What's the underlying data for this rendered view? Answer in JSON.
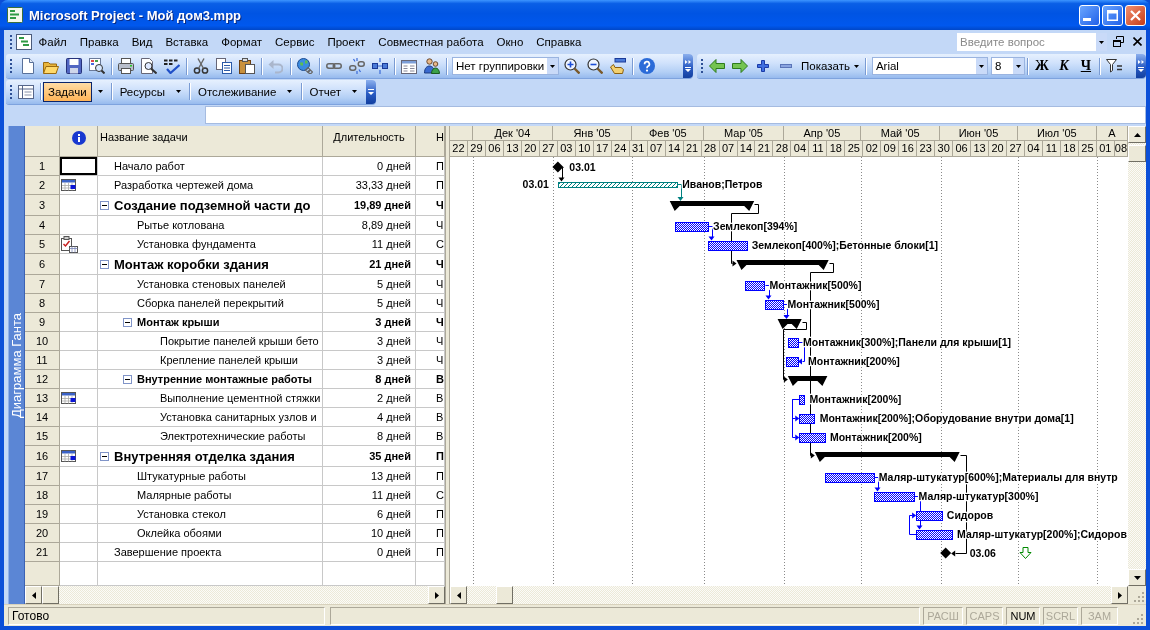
{
  "window": {
    "title": "Microsoft Project - Мой дом3.mpp"
  },
  "menu_bar": {
    "items": [
      "Файл",
      "Правка",
      "Вид",
      "Вставка",
      "Формат",
      "Сервис",
      "Проект",
      "Совместная работа",
      "Окно",
      "Справка"
    ],
    "help_search": {
      "placeholder": "Введите вопрос"
    }
  },
  "standard_toolbar": {
    "undo": {
      "disabled": true
    },
    "grouping": {
      "value": "Нет группировки"
    }
  },
  "formatting_toolbar": {
    "show_button": {
      "label": "Показать"
    },
    "font": {
      "value": "Arial"
    },
    "font_size": {
      "value": "8"
    },
    "style_buttons": [
      "Ж",
      "К",
      "Ч"
    ]
  },
  "guide_toolbar": {
    "items": [
      {
        "label": "Задачи",
        "selected": true
      },
      {
        "label": "Ресурсы",
        "selected": false
      },
      {
        "label": "Отслеживание",
        "selected": false
      },
      {
        "label": "Отчет",
        "selected": false
      }
    ]
  },
  "view_bar": {
    "label": "Диаграмма Ганта"
  },
  "table": {
    "columns": [
      "Название задачи",
      "Длительность",
      "Н"
    ],
    "tasks": [
      {
        "id": "1",
        "kind": "task",
        "name": "Начало работ",
        "duration": "0 дней",
        "start": "П",
        "selected": true
      },
      {
        "id": "2",
        "kind": "constraint",
        "name": "Разработка чертежей дома",
        "duration": "33,33 дней",
        "start": "П",
        "selected": false
      },
      {
        "id": "3",
        "kind": "task",
        "name": "Создание подземной части до",
        "duration": "19,89 дней",
        "start": "Ч",
        "selected": false,
        "expanded": true,
        "children": [
          {
            "id": "4",
            "kind": "task",
            "name": "Рытье котлована",
            "duration": "8,89 дней",
            "start": "Ч",
            "selected": false
          },
          {
            "id": "5",
            "kind": "note",
            "name": "Установка фундамента",
            "duration": "11 дней",
            "start": "С",
            "selected": false
          }
        ]
      },
      {
        "id": "6",
        "kind": "task",
        "name": "Монтаж коробки здания",
        "duration": "21 дней",
        "start": "Ч",
        "selected": false,
        "expanded": true,
        "children": [
          {
            "id": "7",
            "kind": "task",
            "name": "Установка стеновых панелей",
            "duration": "5 дней",
            "start": "Ч",
            "selected": false
          },
          {
            "id": "8",
            "kind": "task",
            "name": "Сборка панелей перекрытий",
            "duration": "5 дней",
            "start": "Ч",
            "selected": false
          },
          {
            "id": "9",
            "kind": "task",
            "name": "Монтаж крыши",
            "duration": "3 дней",
            "start": "Ч",
            "selected": false,
            "expanded": true,
            "children": [
              {
                "id": "10",
                "kind": "task",
                "name": "Покрытие панелей крыши бето",
                "duration": "3 дней",
                "start": "Ч",
                "selected": false
              },
              {
                "id": "11",
                "kind": "task",
                "name": "Крепление панелей крыши",
                "duration": "3 дней",
                "start": "Ч",
                "selected": false
              }
            ]
          },
          {
            "id": "12",
            "kind": "task",
            "name": "Внутренние монтажные работы",
            "duration": "8 дней",
            "start": "В",
            "selected": false,
            "expanded": true,
            "children": [
              {
                "id": "13",
                "kind": "constraint",
                "name": "Выполнение цементной стяжки",
                "duration": "2 дней",
                "start": "В",
                "selected": false
              },
              {
                "id": "14",
                "kind": "task",
                "name": "Установка санитарных узлов и",
                "duration": "4 дней",
                "start": "В",
                "selected": false
              },
              {
                "id": "15",
                "kind": "task",
                "name": "Электротехнические работы",
                "duration": "8 дней",
                "start": "В",
                "selected": false
              }
            ]
          }
        ]
      },
      {
        "id": "16",
        "kind": "constraint",
        "name": "Внутренняя отделка здания",
        "duration": "35 дней",
        "start": "П",
        "selected": false,
        "expanded": true,
        "children": [
          {
            "id": "17",
            "kind": "task",
            "name": "Штукатурные работы",
            "duration": "13 дней",
            "start": "П",
            "selected": false
          },
          {
            "id": "18",
            "kind": "task",
            "name": "Малярные работы",
            "duration": "11 дней",
            "start": "С",
            "selected": false
          },
          {
            "id": "19",
            "kind": "task",
            "name": "Установка стекол",
            "duration": "6 дней",
            "start": "П",
            "selected": false
          },
          {
            "id": "20",
            "kind": "task",
            "name": "Оклейка обоями",
            "duration": "10 дней",
            "start": "П",
            "selected": false
          }
        ]
      },
      {
        "id": "21",
        "kind": "task",
        "name": "Завершение проекта",
        "duration": "0 дней",
        "start": "П",
        "selected": false
      }
    ]
  },
  "gantt": {
    "months": [
      "Дек '04",
      "Янв '05",
      "Фев '05",
      "Мар '05",
      "Апр '05",
      "Май '05",
      "Июн '05",
      "Июл '05",
      "А"
    ],
    "weeks": [
      "22",
      "29",
      "06",
      "13",
      "20",
      "27",
      "03",
      "10",
      "17",
      "24",
      "31",
      "07",
      "14",
      "21",
      "28",
      "07",
      "14",
      "21",
      "28",
      "04",
      "11",
      "18",
      "25",
      "02",
      "09",
      "16",
      "23",
      "30",
      "06",
      "13",
      "20",
      "27",
      "04",
      "11",
      "18",
      "25",
      "01",
      "08"
    ],
    "bars": [
      {
        "kind": "milestone",
        "label": "03.01"
      },
      {
        "kind": "custom",
        "color": "#008080",
        "label": "Иванов;Петров",
        "left_label": "03.01"
      },
      {
        "kind": "summary"
      },
      {
        "kind": "task",
        "color": "#0000ff",
        "label": "Землекоп[394%]"
      },
      {
        "kind": "task",
        "color": "#0000ff",
        "label": "Землекоп[400%];Бетонные блоки[1]"
      },
      {
        "kind": "summary"
      },
      {
        "kind": "task",
        "color": "#0000ff",
        "label": "Монтажник[500%]"
      },
      {
        "kind": "task",
        "color": "#0000ff",
        "label": "Монтажник[500%]"
      },
      {
        "kind": "summary"
      },
      {
        "kind": "task",
        "color": "#0000ff",
        "label": "Монтажник[300%];Панели для крыши[1]"
      },
      {
        "kind": "task",
        "color": "#0000ff",
        "label": "Монтажник[200%]"
      },
      {
        "kind": "summary"
      },
      {
        "kind": "task",
        "color": "#0000ff",
        "label": "Монтажник[200%]"
      },
      {
        "kind": "task",
        "color": "#0000ff",
        "label": "Монтажник[200%];Оборудование внутри дома[1]"
      },
      {
        "kind": "task",
        "color": "#0000ff",
        "label": "Монтажник[200%]"
      },
      {
        "kind": "summary"
      },
      {
        "kind": "task",
        "color": "#0000ff",
        "label": "Маляр-штукатур[600%];Материалы для внутр"
      },
      {
        "kind": "task",
        "color": "#0000ff",
        "label": "Маляр-штукатур[300%]"
      },
      {
        "kind": "task",
        "color": "#0000ff",
        "label": "Сидоров"
      },
      {
        "kind": "task",
        "color": "#0000ff",
        "label": "Маляр-штукатур[200%];Сидоров"
      },
      {
        "kind": "milestone",
        "label": "03.06",
        "deadline": true
      }
    ]
  },
  "status_bar": {
    "text": "Готово",
    "indicators": [
      {
        "label": "РАСШ",
        "on": false
      },
      {
        "label": "CAPS",
        "on": false
      },
      {
        "label": "NUM",
        "on": true
      },
      {
        "label": "SCRL",
        "on": false
      },
      {
        "label": "ЗАМ",
        "on": false
      }
    ]
  }
}
